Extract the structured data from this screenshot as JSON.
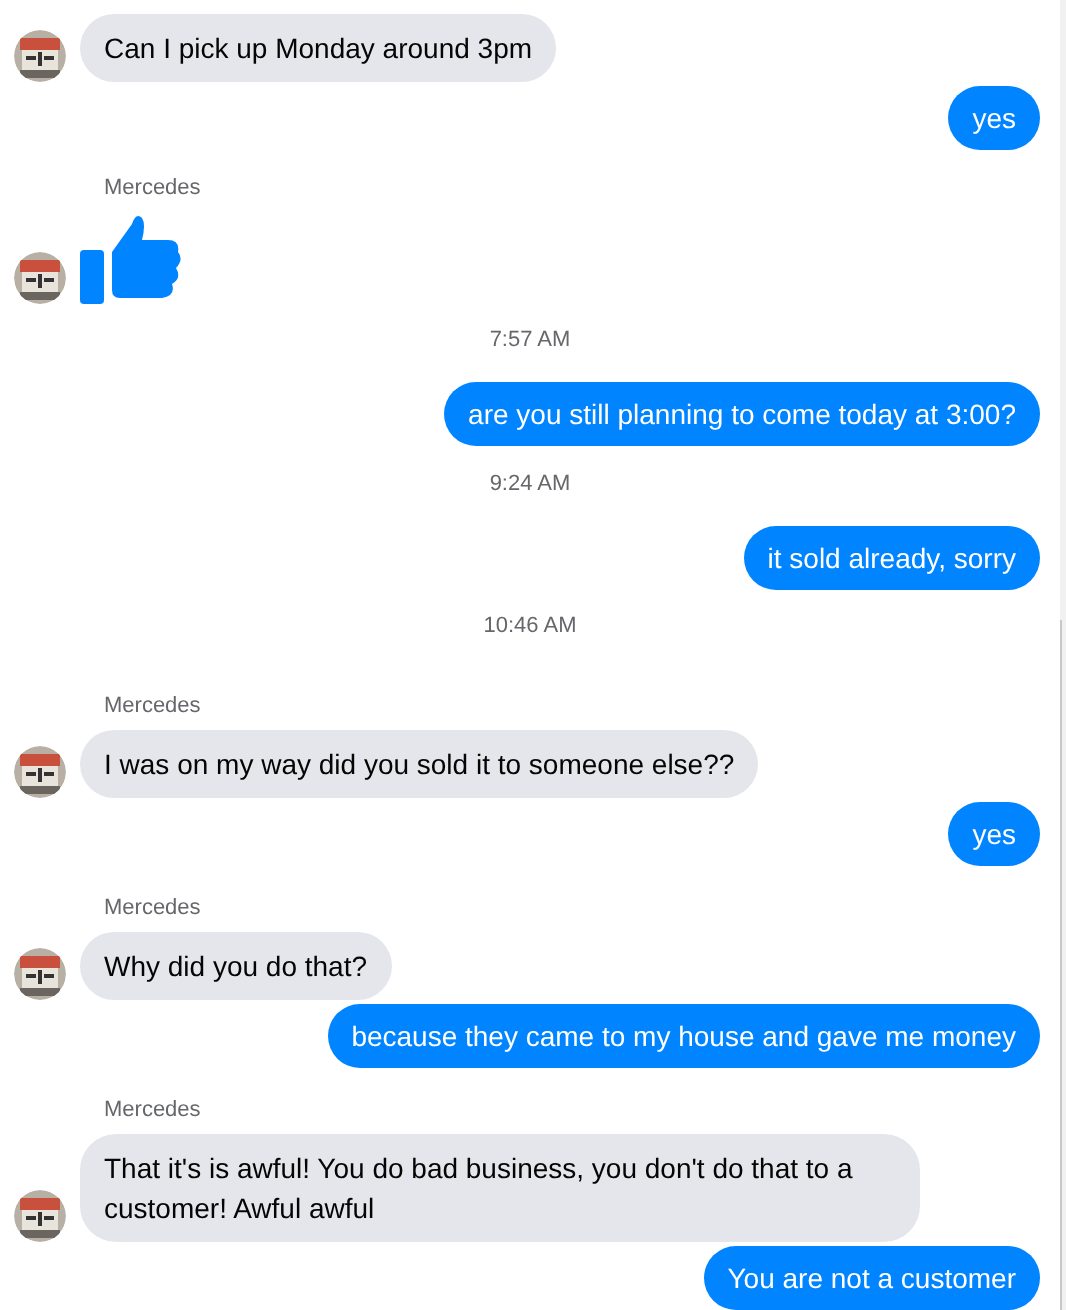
{
  "messages": [
    {
      "kind": "incoming",
      "text": "Can I pick up Monday around 3pm"
    },
    {
      "kind": "outgoing",
      "text": "yes"
    },
    {
      "kind": "like",
      "sender": "Mercedes"
    },
    {
      "kind": "timestamp",
      "text": "7:57 AM"
    },
    {
      "kind": "outgoing",
      "text": "are you still planning to come today at 3:00?"
    },
    {
      "kind": "timestamp",
      "text": "9:24 AM"
    },
    {
      "kind": "outgoing",
      "text": "it sold already, sorry"
    },
    {
      "kind": "timestamp",
      "text": "10:46 AM"
    },
    {
      "kind": "incoming",
      "sender": "Mercedes",
      "text": "I was on my way did you sold it to someone else??"
    },
    {
      "kind": "outgoing",
      "text": "yes"
    },
    {
      "kind": "incoming",
      "sender": "Mercedes",
      "text": "Why did you do that?"
    },
    {
      "kind": "outgoing",
      "text": "because they came to my house and gave me money"
    },
    {
      "kind": "incoming",
      "sender": "Mercedes",
      "text": "That it's is awful! You do bad business, you don't do that to a customer! Awful awful"
    },
    {
      "kind": "outgoing",
      "text": "You are not a customer"
    }
  ]
}
